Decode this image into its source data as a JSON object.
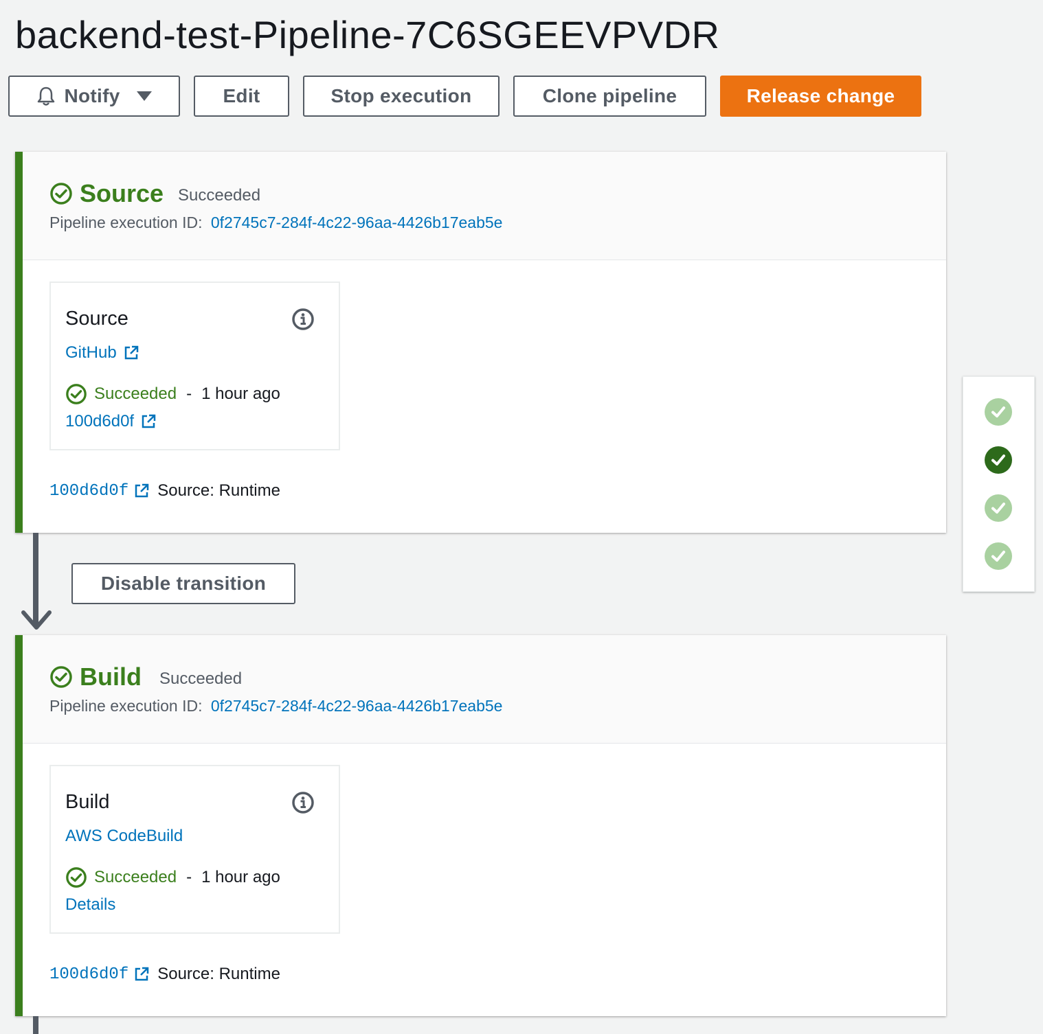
{
  "page": {
    "title": "backend-test-Pipeline-7C6SGEEVPVDR"
  },
  "toolbar": {
    "notify_label": "Notify",
    "edit_label": "Edit",
    "stop_label": "Stop execution",
    "clone_label": "Clone pipeline",
    "release_label": "Release change"
  },
  "colors": {
    "success": "#3b7f1d",
    "link": "#0073bb",
    "primary": "#ec7211",
    "success_light": "#a9d1a0"
  },
  "stages": [
    {
      "name": "Source",
      "status": "Succeeded",
      "exec_label": "Pipeline execution ID:",
      "exec_id": "0f2745c7-284f-4c22-96aa-4426b17eab5e",
      "action": {
        "name": "Source",
        "provider": "GitHub",
        "status": "Succeeded",
        "separator": "-",
        "time": "1 hour ago",
        "link": "100d6d0f"
      },
      "revision": {
        "id": "100d6d0f",
        "source": "Source: Runtime"
      }
    },
    {
      "name": "Build",
      "status": "Succeeded",
      "exec_label": "Pipeline execution ID:",
      "exec_id": "0f2745c7-284f-4c22-96aa-4426b17eab5e",
      "action": {
        "name": "Build",
        "provider": "AWS CodeBuild",
        "status": "Succeeded",
        "separator": "-",
        "time": "1 hour ago",
        "link": "Details"
      },
      "revision": {
        "id": "100d6d0f",
        "source": "Source: Runtime"
      }
    }
  ],
  "transition": {
    "disable_label": "Disable transition"
  },
  "mini_map": {
    "steps": [
      "succeeded",
      "current",
      "succeeded",
      "succeeded"
    ]
  }
}
